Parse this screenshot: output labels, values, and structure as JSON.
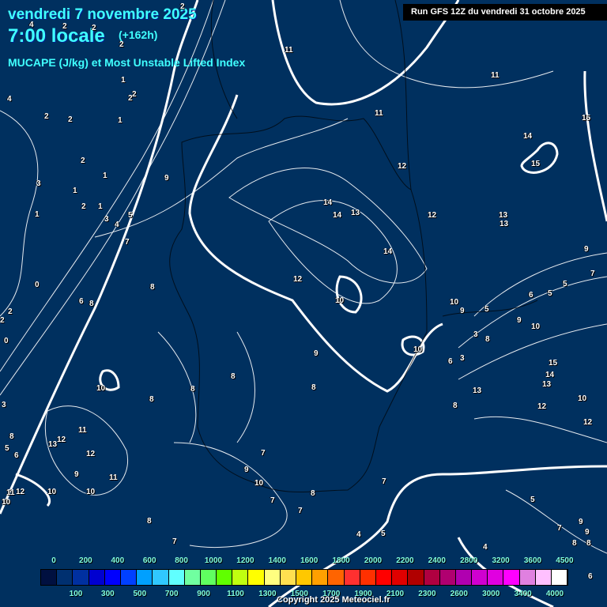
{
  "header": {
    "date": "vendredi 7 novembre 2025",
    "time": "7:00 locale",
    "lead": "(+162h)",
    "title": "MUCAPE (J/kg) et Most Unstable Lifted Index",
    "run": "Run GFS 12Z du vendredi 31 octobre 2025"
  },
  "contour_labels": [
    "11",
    "11",
    "11",
    "15",
    "14",
    "15",
    "12",
    "14",
    "14",
    "13",
    "12",
    "13",
    "13",
    "14",
    "12",
    "10",
    "10",
    "9",
    "8",
    "8",
    "8",
    "8",
    "10",
    "8",
    "6",
    "8",
    "0",
    "2",
    "2",
    "0",
    "3",
    "8",
    "5",
    "6",
    "12",
    "13",
    "11",
    "12",
    "11",
    "9",
    "10",
    "10",
    "11",
    "12",
    "10",
    "9",
    "10",
    "7",
    "7",
    "8",
    "7",
    "7",
    "5",
    "4",
    "8",
    "7",
    "4",
    "5",
    "7",
    "9",
    "9",
    "8",
    "8",
    "6",
    "10",
    "9",
    "5",
    "6",
    "5",
    "5",
    "7",
    "9",
    "9",
    "10",
    "8",
    "3",
    "6",
    "3",
    "15",
    "14",
    "13",
    "13",
    "12",
    "10",
    "12",
    "8",
    "3",
    "1",
    "2",
    "1",
    "3",
    "4",
    "5",
    "7",
    "9",
    "1",
    "2",
    "1",
    "2",
    "2",
    "1",
    "1",
    "2",
    "2",
    "4",
    "4",
    "2",
    "2",
    "2",
    "2"
  ],
  "legend": {
    "colors": [
      "#001040",
      "#003070",
      "#0030a0",
      "#0000d0",
      "#0000ff",
      "#0040ff",
      "#00a0ff",
      "#30c8ff",
      "#60ffff",
      "#70ffa0",
      "#60ff60",
      "#60ff00",
      "#c0ff10",
      "#ffff00",
      "#ffff80",
      "#ffe050",
      "#ffc800",
      "#ffa000",
      "#ff6400",
      "#ff3030",
      "#ff3000",
      "#ff0000",
      "#e00000",
      "#b00000",
      "#b00040",
      "#b00070",
      "#b000b0",
      "#d000d0",
      "#e000e0",
      "#ff00ff",
      "#e080e0",
      "#ffc0ff",
      "#ffffff"
    ],
    "top_labels": [
      "0",
      "200",
      "400",
      "600",
      "800",
      "1000",
      "1200",
      "1400",
      "1600",
      "1800",
      "2000",
      "2200",
      "2400",
      "2800",
      "3200",
      "3600",
      "4500"
    ],
    "bottom_labels": [
      "100",
      "300",
      "500",
      "700",
      "900",
      "1100",
      "1300",
      "1500",
      "1700",
      "1900",
      "2100",
      "2300",
      "2600",
      "3000",
      "3400",
      "4000"
    ]
  },
  "copyright": "Copyright 2025 Meteociel.fr"
}
